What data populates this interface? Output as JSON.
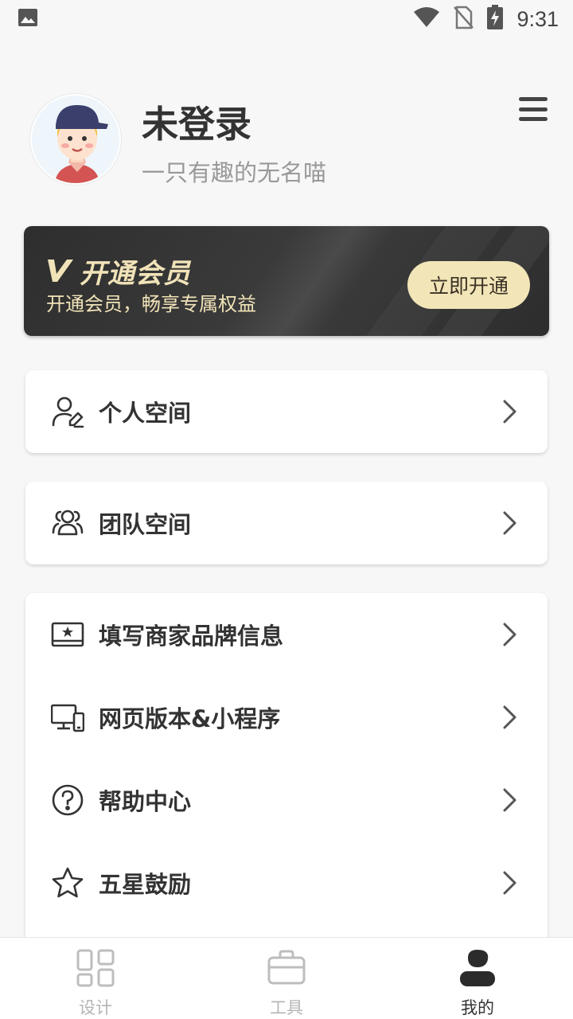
{
  "status_bar": {
    "time": "9:31",
    "icons": [
      "image-notification-icon",
      "wifi-icon",
      "no-sim-icon",
      "battery-charging-icon"
    ]
  },
  "profile": {
    "name": "未登录",
    "tagline": "一只有趣的无名喵",
    "avatar_icon": "cartoon-avatar",
    "menu_icon": "hamburger-menu-icon"
  },
  "vip": {
    "title": "开通会员",
    "subtitle": "开通会员，畅享专属权益",
    "button_label": "立即开通",
    "accent_color": "#f1e3b8"
  },
  "cards": [
    {
      "items": [
        {
          "label": "个人空间",
          "icon": "user-edit-icon"
        }
      ]
    },
    {
      "items": [
        {
          "label": "团队空间",
          "icon": "team-icon"
        }
      ]
    },
    {
      "items": [
        {
          "label": "填写商家品牌信息",
          "icon": "brand-card-icon"
        },
        {
          "label": "网页版本&小程序",
          "icon": "monitor-phone-icon"
        },
        {
          "label": "帮助中心",
          "icon": "help-icon"
        },
        {
          "label": "五星鼓励",
          "icon": "star-icon"
        }
      ]
    }
  ],
  "bottom_nav": {
    "items": [
      {
        "label": "设计",
        "icon": "grid-icon",
        "active": false
      },
      {
        "label": "工具",
        "icon": "briefcase-icon",
        "active": false
      },
      {
        "label": "我的",
        "icon": "profile-icon",
        "active": true
      }
    ]
  }
}
